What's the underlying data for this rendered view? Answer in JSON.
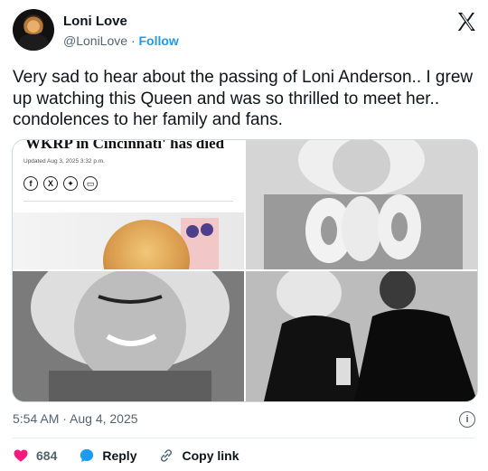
{
  "author": {
    "name": "Loni Love",
    "handle": "@LoniLove",
    "separator": "·",
    "follow_label": "Follow",
    "logo_icon": "x-logo-icon"
  },
  "tweet": {
    "text": "Very sad to hear about the passing of Loni Anderson.. I grew up watching this Queen and was so thrilled to meet her.. condolences to her family and fans."
  },
  "media": {
    "article_headline": "WKRP in Cincinnati' has died",
    "article_updated": "Updated Aug 3, 2025 3:32 p.m.",
    "share_icons": [
      "facebook-icon",
      "x-icon",
      "bluesky-icon",
      "email-icon"
    ],
    "share_glyphs": [
      "f",
      "X",
      "✦",
      "▭"
    ]
  },
  "meta": {
    "timestamp": "5:54 AM · Aug 4, 2025",
    "info_glyph": "i"
  },
  "actions": {
    "likes_count": "684",
    "reply_label": "Reply",
    "copy_link_label": "Copy link"
  },
  "colors": {
    "accent": "#1d9bf0",
    "like": "#f91880",
    "muted": "#536471"
  }
}
